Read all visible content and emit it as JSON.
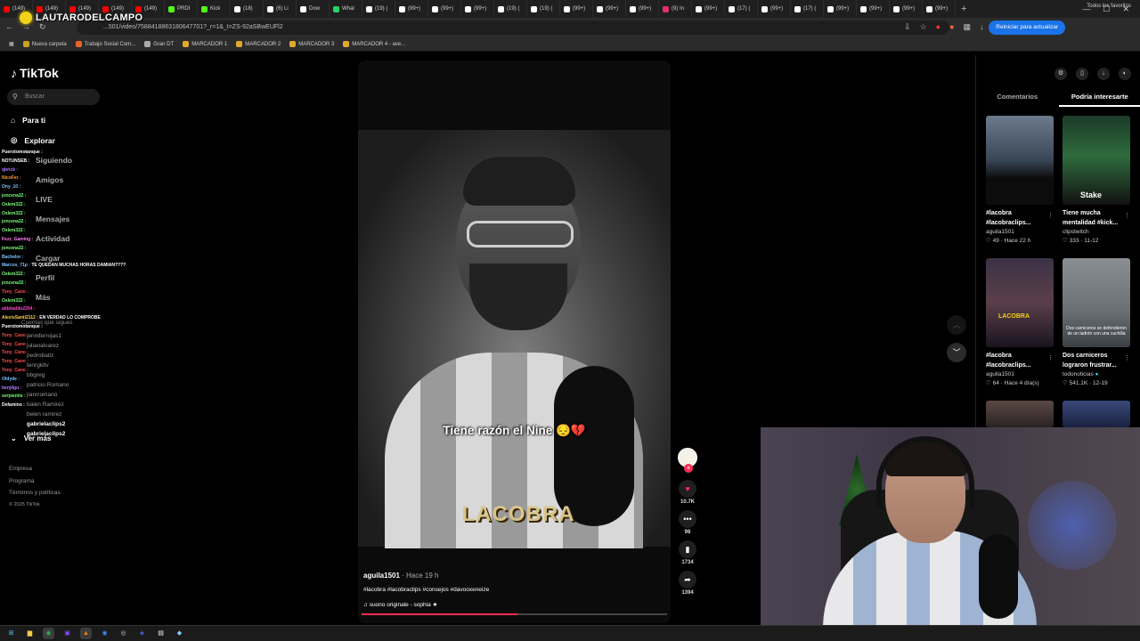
{
  "browser": {
    "tabs": [
      {
        "label": "(149)",
        "color": "#ff0000"
      },
      {
        "label": "(149)",
        "color": "#ff0000"
      },
      {
        "label": "(149)",
        "color": "#ff0000"
      },
      {
        "label": "(149)",
        "color": "#ff0000"
      },
      {
        "label": "(149)",
        "color": "#ff0000"
      },
      {
        "label": "PRDI",
        "color": "#53fc18"
      },
      {
        "label": "Kick",
        "color": "#53fc18"
      },
      {
        "label": "(18)",
        "color": "#ffffff"
      },
      {
        "label": "(6) Li",
        "color": "#ffffff"
      },
      {
        "label": "Dow",
        "color": "#ffffff"
      },
      {
        "label": "Whal",
        "color": "#25d366"
      },
      {
        "label": "(19) (",
        "color": "#ffffff"
      },
      {
        "label": "(99+)",
        "color": "#ffffff"
      },
      {
        "label": "(99+)",
        "color": "#ffffff"
      },
      {
        "label": "(99+)",
        "color": "#ffffff"
      },
      {
        "label": "(19) (",
        "color": "#ffffff"
      },
      {
        "label": "(19) (",
        "color": "#ffffff"
      },
      {
        "label": "(99+)",
        "color": "#ffffff"
      },
      {
        "label": "(99+)",
        "color": "#ffffff"
      },
      {
        "label": "(99+)",
        "color": "#ffffff"
      },
      {
        "label": "(9) In",
        "color": "#e1306c"
      },
      {
        "label": "(99+)",
        "color": "#ffffff"
      },
      {
        "label": "(17) (",
        "color": "#ffffff"
      },
      {
        "label": "(99+)",
        "color": "#ffffff"
      },
      {
        "label": "(17) (",
        "color": "#ffffff"
      },
      {
        "label": "(99+)",
        "color": "#ffffff"
      },
      {
        "label": "(99+)",
        "color": "#ffffff"
      },
      {
        "label": "(99+)",
        "color": "#ffffff"
      },
      {
        "label": "(99+)",
        "color": "#ffffff"
      }
    ],
    "url": "...501/video/7588418863180647701?_r=1&_t=ZS-92aSBwEUFl2",
    "update_label": "Reiniciar para actualizar",
    "bookmarks": [
      {
        "label": "Nueva carpeta",
        "color": "#c9a227"
      },
      {
        "label": "Trabajo Social Com...",
        "color": "#e8632b"
      },
      {
        "label": "Gran DT",
        "color": "#aaaaaa"
      },
      {
        "label": "MARCADOR 1",
        "color": "#e0a82e"
      },
      {
        "label": "MARCADOR 2",
        "color": "#e0a82e"
      },
      {
        "label": "MARCADOR 3",
        "color": "#e0a82e"
      },
      {
        "label": "MARCADOR 4 - ave...",
        "color": "#e0a82e"
      }
    ],
    "all_bookmarks": "Todos los favoritos"
  },
  "stream_overlay": {
    "name": "LAUTARODELCAMPO"
  },
  "sidebar": {
    "logo": "TikTok",
    "search_placeholder": "Buscar",
    "nav": [
      "Para ti",
      "Explorar",
      "Siguiendo",
      "Amigos",
      "LIVE",
      "Mensajes",
      "Actividad",
      "Cargar",
      "Perfil",
      "Más"
    ],
    "following_title": "Cuentas que sigues",
    "following": [
      "jenniferrojas1",
      "julianalvarez",
      "pedrobatiz",
      "tenrgkltv",
      "bbgreg",
      "patricio Romano",
      "jianrromano",
      "balen Ramirez",
      "belen ramirez",
      "gabrielaclips2",
      "gabrielaclips2"
    ],
    "see_more": "Ver más",
    "footer": [
      "Empresa",
      "Programa",
      "Términos y políticas",
      "© 2025 TikTok"
    ]
  },
  "chat": [
    {
      "user": "Puerotomotanque",
      "msg": "",
      "color": "#ffffff"
    },
    {
      "user": "NOTUNSEB",
      "msg": "",
      "color": "#ffffff"
    },
    {
      "user": "qbrick",
      "msg": "",
      "color": "#b57cff"
    },
    {
      "user": "NicoFer",
      "msg": "",
      "color": "#ff9d2e"
    },
    {
      "user": "Ony_10",
      "msg": "",
      "color": "#7cc4ff"
    },
    {
      "user": "joncena32",
      "msg": "",
      "color": "#7cff7c"
    },
    {
      "user": "Oslem322",
      "msg": "",
      "color": "#7cff7c"
    },
    {
      "user": "Oslem322",
      "msg": "",
      "color": "#7cff7c"
    },
    {
      "user": "joncena32",
      "msg": "",
      "color": "#7cff7c"
    },
    {
      "user": "Oslem322",
      "msg": "",
      "color": "#7cff7c"
    },
    {
      "user": "Fezz_Gaming",
      "msg": "",
      "color": "#ff7cf1"
    },
    {
      "user": "joncena32",
      "msg": "",
      "color": "#7cff7c"
    },
    {
      "user": "Bachelor",
      "msg": "",
      "color": "#7cc4ff"
    },
    {
      "user": "Marcos_71p",
      "msg": "TE QUEDAN MUCHAS HORAS DAMIAN????",
      "color": "#7cc4ff"
    },
    {
      "user": "Oslem322",
      "msg": "",
      "color": "#7cff7c"
    },
    {
      "user": "joncena32",
      "msg": "",
      "color": "#7cff7c"
    },
    {
      "user": "Tony_Cano",
      "msg": "",
      "color": "#ff4b4b"
    },
    {
      "user": "Oslem322",
      "msg": "",
      "color": "#7cff7c"
    },
    {
      "user": "aldebaldo2204",
      "msg": "",
      "color": "#ff4bd2"
    },
    {
      "user": "AlexisSanti2112",
      "msg": "EN VERDAD LO COMPROBE",
      "color": "#ffd24b"
    },
    {
      "user": "Puerotomotanque",
      "msg": "",
      "color": "#ffffff"
    },
    {
      "user": "Tony_Cano",
      "msg": "",
      "color": "#ff4b4b"
    },
    {
      "user": "Tony_Cano",
      "msg": "",
      "color": "#ff4b4b"
    },
    {
      "user": "Tony_Cano",
      "msg": "",
      "color": "#ff4b4b"
    },
    {
      "user": "Tony_Cano",
      "msg": "",
      "color": "#ff4b4b"
    },
    {
      "user": "Tony_Cano",
      "msg": "",
      "color": "#ff4b4b"
    },
    {
      "user": "Oldyde",
      "msg": "",
      "color": "#7cc4ff"
    },
    {
      "user": "benj4gu",
      "msg": "",
      "color": "#b57cff"
    },
    {
      "user": "serpientis",
      "msg": "",
      "color": "#7cff7c"
    },
    {
      "user": "Defamino",
      "msg": "",
      "color": "#ffffff"
    }
  ],
  "video": {
    "caption": "Tiene razón el Nine 😔💔",
    "brand": "LACOBRA",
    "author": "aguila1501",
    "time": " · Hace 19 h",
    "tags": "#lacobra #lacobraclips #consejos #davooxeneize",
    "sound": "suono originale - sophia ★",
    "progress": 0.51,
    "likes": "10.7K",
    "comments": "98",
    "saves": "1734",
    "shares": "1394"
  },
  "right_panel": {
    "tabs": [
      "Comentarios",
      "Podría interesarte"
    ],
    "active_tab": 1,
    "cards": [
      {
        "title": "#lacobra #lacobraclips...",
        "author": "aguila1501",
        "meta": "49 · Hace 22 h"
      },
      {
        "title": "Tiene mucha mentalidad #kick...",
        "author": "clipstwitch",
        "meta": "333 · 11-12"
      },
      {
        "title": "#lacobra #lacobraclips...",
        "author": "aguila1501",
        "meta": "64 · Hace 4 día(s)"
      },
      {
        "title": "Dos carniceros lograron frustrar...",
        "author": "todonoticias",
        "meta": "541.1K · 12-19"
      }
    ],
    "thumb_texts": [
      "Stake",
      "LACOBRA",
      "Dos carniceros se defendieron de un ladrón con una cuchilla"
    ]
  },
  "taskbar": {
    "icons": [
      {
        "name": "windows-start-icon",
        "glyph": "⊞",
        "color": "#4cc2ff"
      },
      {
        "name": "file-explorer-icon",
        "glyph": "▆",
        "color": "#f7c948"
      },
      {
        "name": "chrome-icon",
        "glyph": "◉",
        "color": "#34a853"
      },
      {
        "name": "twitch-icon",
        "glyph": "▣",
        "color": "#9146ff"
      },
      {
        "name": "vlc-icon",
        "glyph": "▲",
        "color": "#ff8800"
      },
      {
        "name": "browser-icon",
        "glyph": "◉",
        "color": "#4285f4"
      },
      {
        "name": "obs-icon",
        "glyph": "◎",
        "color": "#cccccc"
      },
      {
        "name": "discord-icon",
        "glyph": "◈",
        "color": "#5865f2"
      },
      {
        "name": "terminal-icon",
        "glyph": "▤",
        "color": "#ffffff"
      },
      {
        "name": "app-icon",
        "glyph": "◆",
        "color": "#7fd3ff"
      }
    ]
  }
}
